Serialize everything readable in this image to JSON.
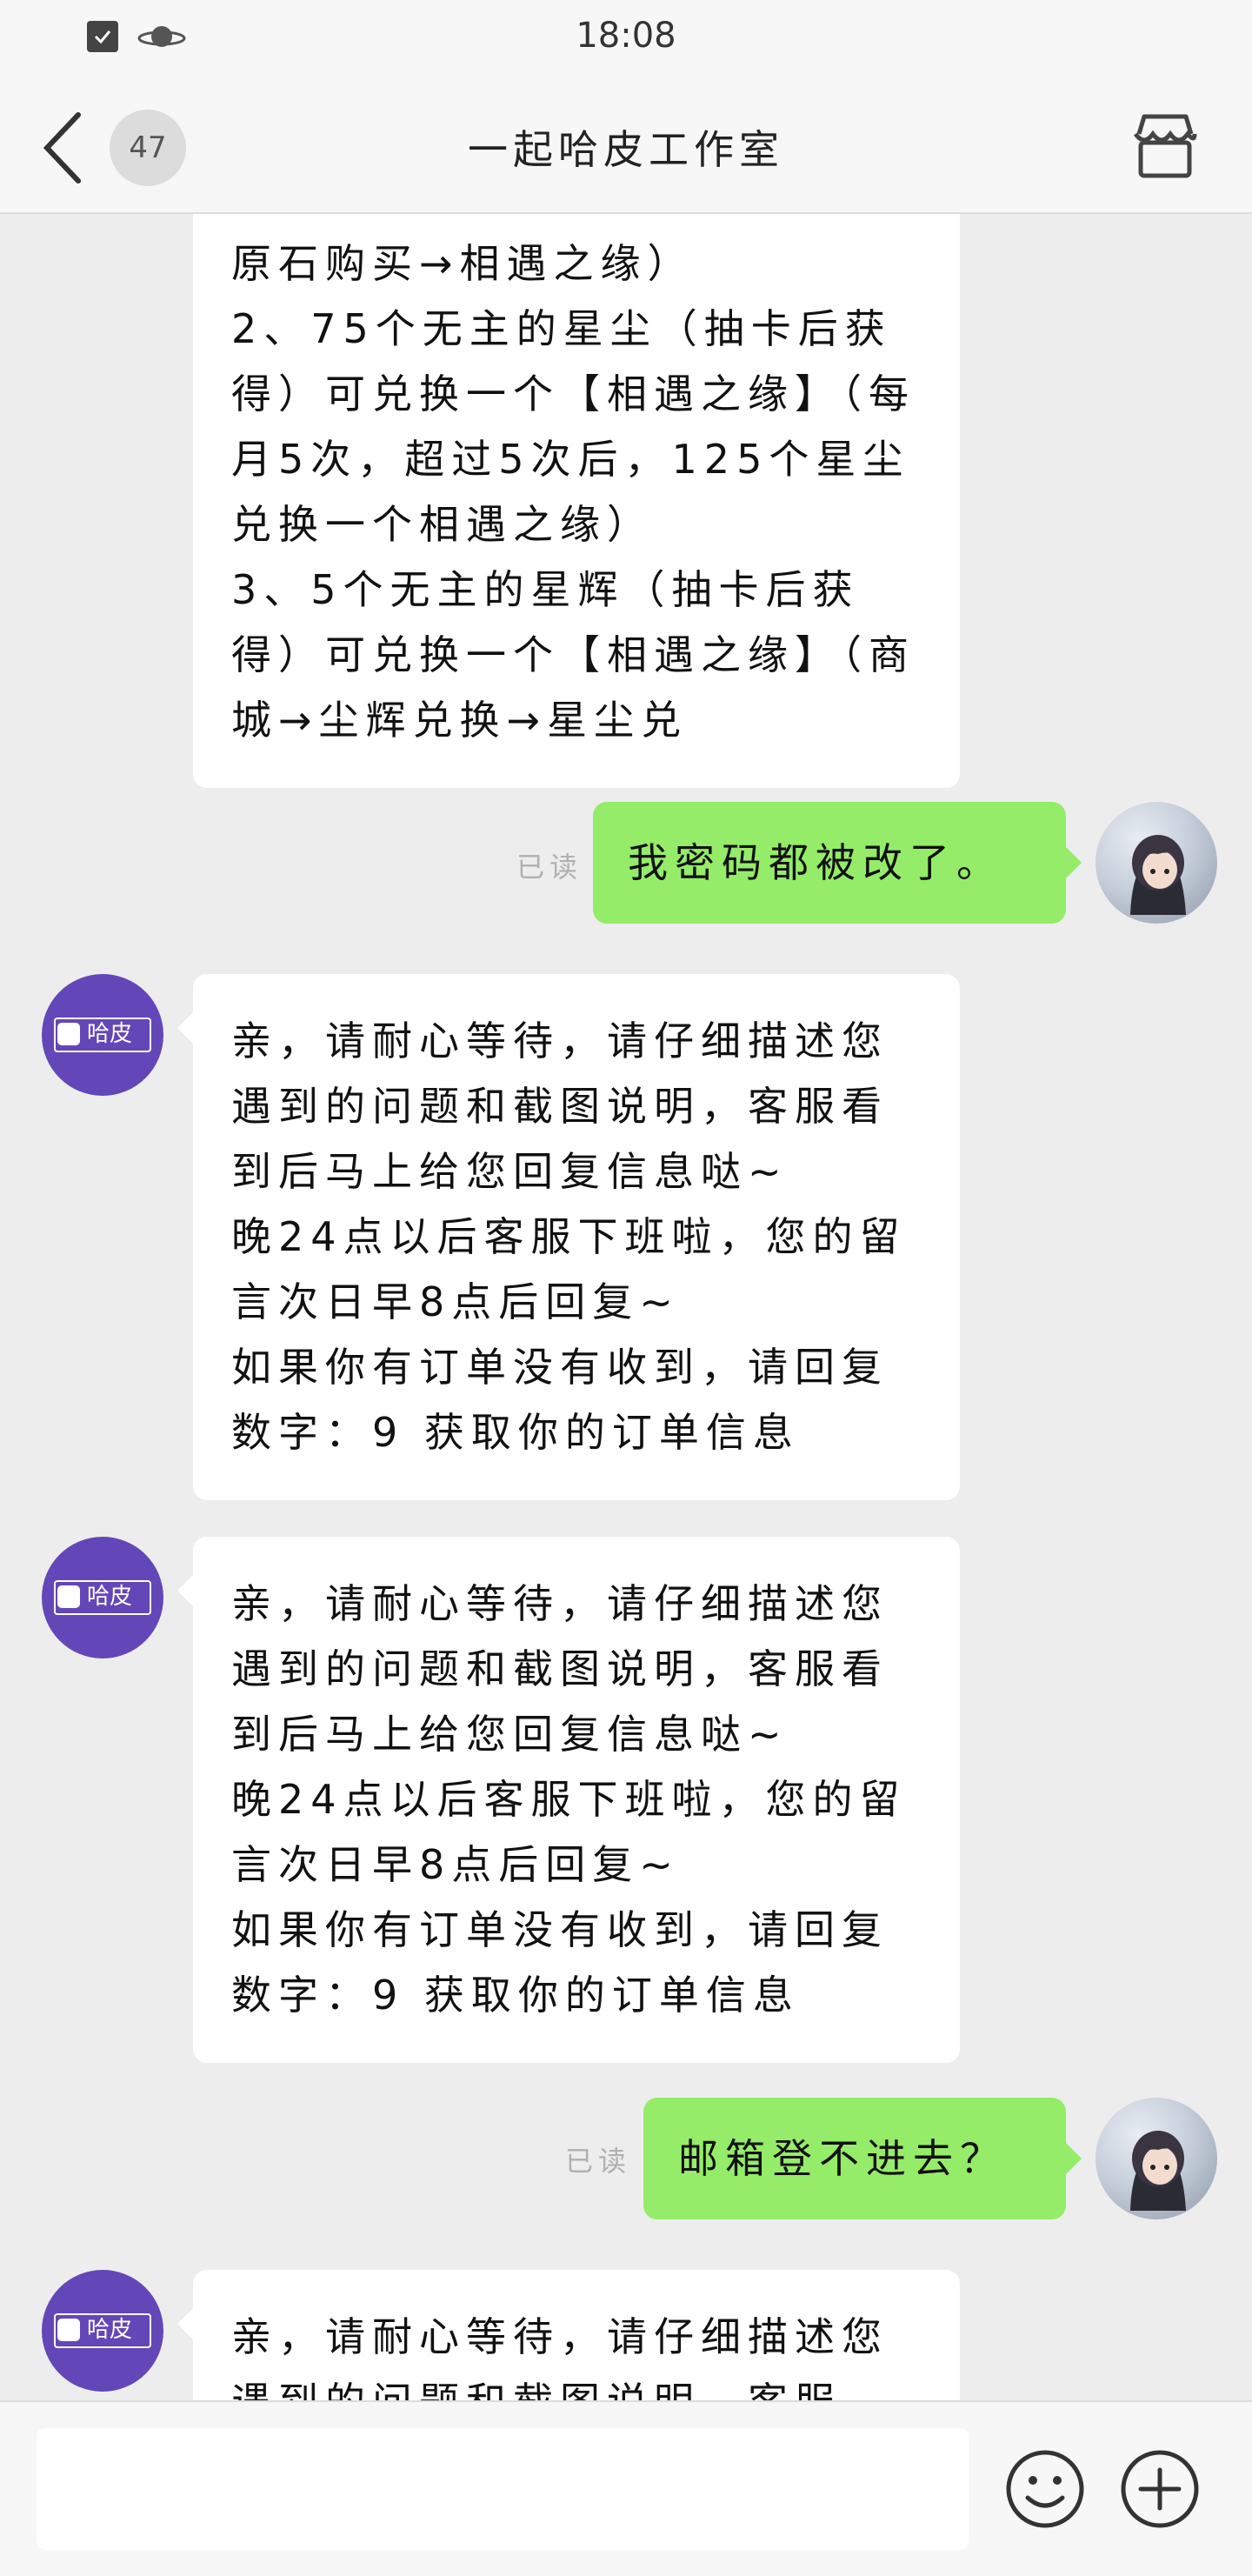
{
  "status_bar": {
    "time": "18:08"
  },
  "header": {
    "unread_count": "47",
    "title": "一起哈皮工作室"
  },
  "messages": [
    {
      "side": "left",
      "text": "原石购买→相遇之缘）\n2、75个无主的星尘（抽卡后获得）可兑换一个【相遇之缘】（每月5次，超过5次后，125个星尘兑换一个相遇之缘）\n3、5个无主的星辉（抽卡后获得）可兑换一个【相遇之缘】（商城→尘辉兑换→星尘兑"
    },
    {
      "side": "right",
      "read_label": "已读",
      "text": "我密码都被改了。"
    },
    {
      "side": "left",
      "avatar_label": "哈皮",
      "text": "亲，请耐心等待，请仔细描述您遇到的问题和截图说明，客服看到后马上给您回复信息哒~\n晚24点以后客服下班啦，您的留言次日早8点后回复~\n如果你有订单没有收到，请回复数字：9 获取你的订单信息"
    },
    {
      "side": "left",
      "avatar_label": "哈皮",
      "text": "亲，请耐心等待，请仔细描述您遇到的问题和截图说明，客服看到后马上给您回复信息哒~\n晚24点以后客服下班啦，您的留言次日早8点后回复~\n如果你有订单没有收到，请回复数字：9 获取你的订单信息"
    },
    {
      "side": "right",
      "read_label": "已读",
      "text": "邮箱登不进去？"
    },
    {
      "side": "left",
      "avatar_label": "哈皮",
      "text": "亲，请耐心等待，请仔细描述您遇到的问题和截图说明，客服"
    }
  ],
  "input": {
    "value": "",
    "placeholder": ""
  },
  "icons": {
    "status": [
      "checkbox-icon",
      "planet-icon"
    ],
    "header": [
      "back-arrow-icon",
      "shop-icon"
    ],
    "input": [
      "emoji-icon",
      "plus-icon"
    ]
  },
  "colors": {
    "background": "#ededed",
    "outgoing_bubble": "#95ec69",
    "incoming_bubble": "#ffffff",
    "shop_avatar": "#6347b8"
  }
}
